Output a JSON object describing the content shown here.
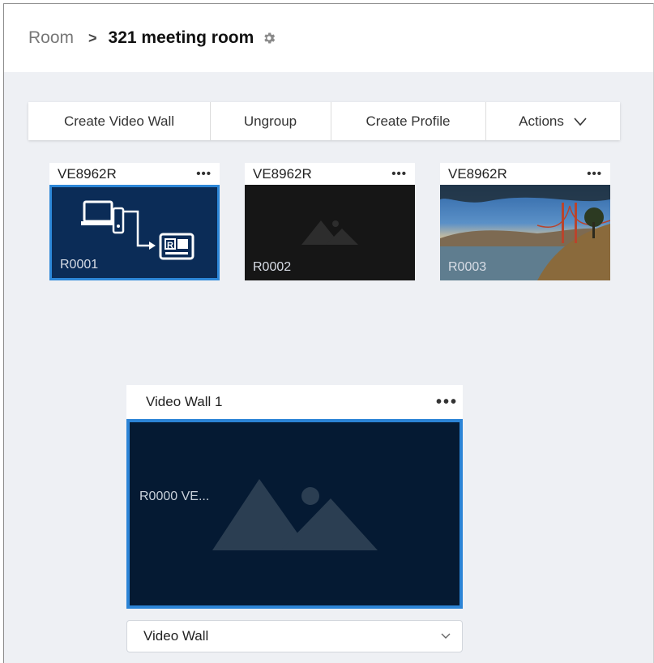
{
  "breadcrumb": {
    "root": "Room",
    "separator": ">",
    "current": "321 meeting room",
    "settings_icon": "gear-icon"
  },
  "toolbar": {
    "create_video_wall": "Create Video Wall",
    "ungroup": "Ungroup",
    "create_profile": "Create Profile",
    "actions": "Actions",
    "actions_icon": "chevron-down-icon"
  },
  "receivers": [
    {
      "model": "VE8962R",
      "menu": "•••",
      "id": "R0001",
      "preview": "connection-diagram",
      "selected": true
    },
    {
      "model": "VE8962R",
      "menu": "•••",
      "id": "R0002",
      "preview": "image-placeholder",
      "selected": false
    },
    {
      "model": "VE8962R",
      "menu": "•••",
      "id": "R0003",
      "preview": "landscape-photo",
      "selected": false
    }
  ],
  "video_wall": {
    "title": "Video Wall 1",
    "menu": "•••",
    "screen_label": "R0000 VE...",
    "preview_icon": "image-placeholder-icon"
  },
  "layout_select": {
    "value": "Video Wall",
    "icon": "chevron-down-icon"
  },
  "colors": {
    "accent": "#2d87d8",
    "selected_thumb_bg": "#0b2c57",
    "wall_bg": "#051a33",
    "page_bg": "#eef0f4"
  }
}
